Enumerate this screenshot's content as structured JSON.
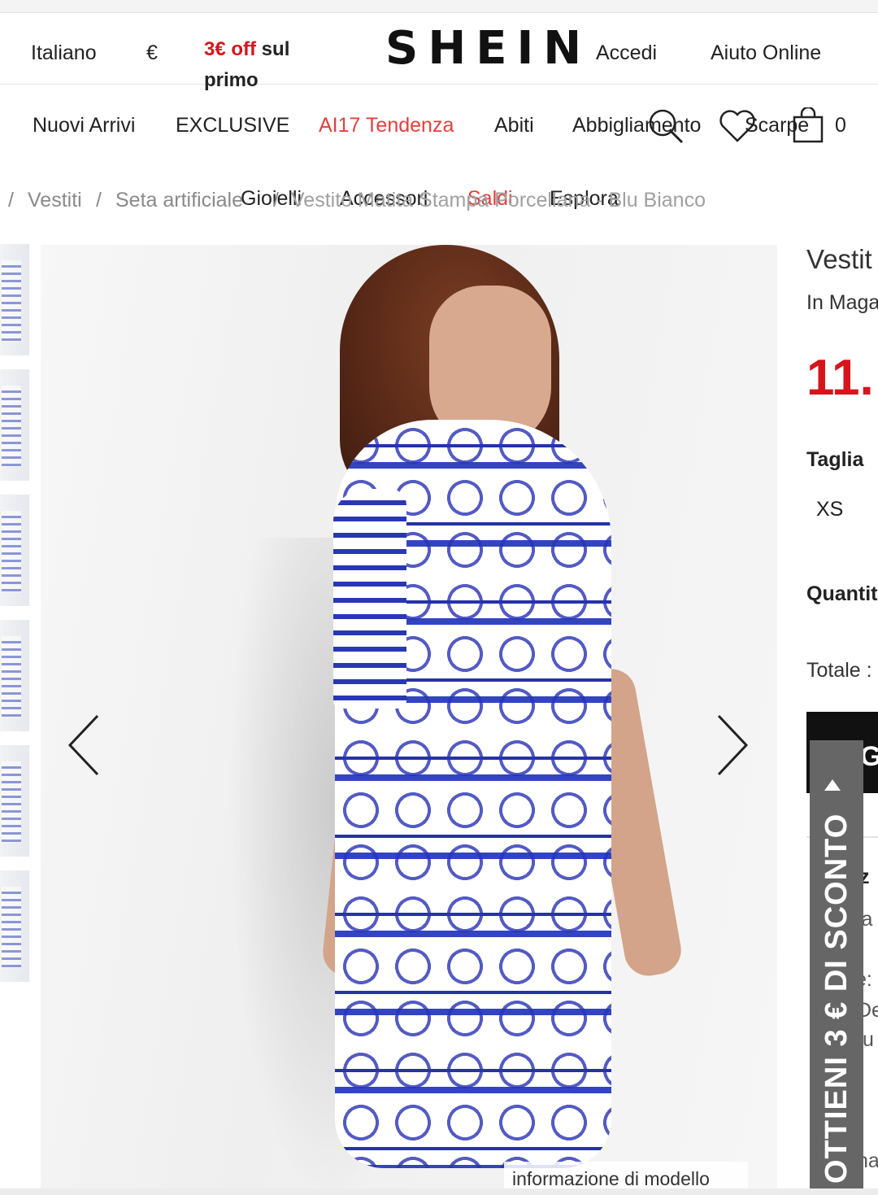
{
  "header": {
    "language": "Italiano",
    "currency": "€",
    "promo_red": "3€ off",
    "promo_rest": " sul primo",
    "logo": "SHEIN",
    "login": "Accedi",
    "help": "Aiuto Online"
  },
  "nav": {
    "items": [
      "Nuovi Arrivi",
      "EXCLUSIVE",
      "AI17 Tendenza",
      "Abiti",
      "Abbigliamento",
      "Scarpe"
    ],
    "items_row2": [
      "Gioielli",
      "Accessori",
      "Saldi",
      "Esplora"
    ],
    "cart_count": "0"
  },
  "breadcrumb": {
    "sep": "/",
    "items": [
      "Vestiti",
      "Seta artificiale",
      "Vestito Matita Stampa Porcellana - Blu Bianco"
    ]
  },
  "gallery": {
    "model_info": "informazione di modello"
  },
  "product": {
    "title": "Vestit",
    "stock": "In Maga",
    "price": "11.",
    "size_label": "Taglia",
    "size_option": "XS",
    "quantity_label": "Quantit",
    "total_label": "Totale :",
    "add_btn": "G",
    "desc_1": "iz",
    "desc_2": "ia",
    "desc_3": "e: ",
    "desc_4": "De",
    "desc_5": "tu",
    "desc_6": "na"
  },
  "discount_tab": {
    "label": "OTTIENI 3 € DI SCONTO"
  },
  "colors": {
    "accent_red": "#d6141c",
    "nav_hot": "#e0413f",
    "tab_gray": "#666666"
  }
}
